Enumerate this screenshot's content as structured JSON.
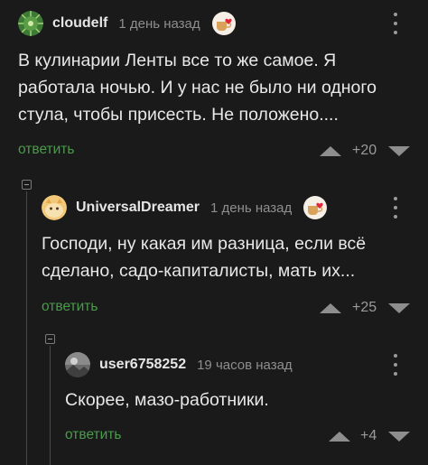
{
  "comments": [
    {
      "username": "cloudelf",
      "timestamp": "1 день назад",
      "text": "В кулинарии Ленты все то же самое. Я работала ночью. И у нас не было ни одного стула, чтобы присесть. Не положено....",
      "reply_label": "ответить",
      "rating": "+20",
      "avatar_icon": "watermelon-avatar",
      "badge_icon": "heart-coffee-badge"
    },
    {
      "username": "UniversalDreamer",
      "timestamp": "1 день назад",
      "text": "Господи, ну какая им разница, если всё сделано, садо-капиталисты, мать их...",
      "reply_label": "ответить",
      "rating": "+25",
      "avatar_icon": "cat-avatar",
      "badge_icon": "heart-coffee-badge"
    },
    {
      "username": "user6758252",
      "timestamp": "19 часов назад",
      "text": "Скорее, мазо-работники.",
      "reply_label": "ответить",
      "rating": "+4",
      "avatar_icon": "photo-avatar"
    }
  ],
  "colors": {
    "background": "#1a1a1b",
    "reply_link": "#4a9b4a",
    "text": "#e8e8e8",
    "muted": "#8e8e8e"
  }
}
